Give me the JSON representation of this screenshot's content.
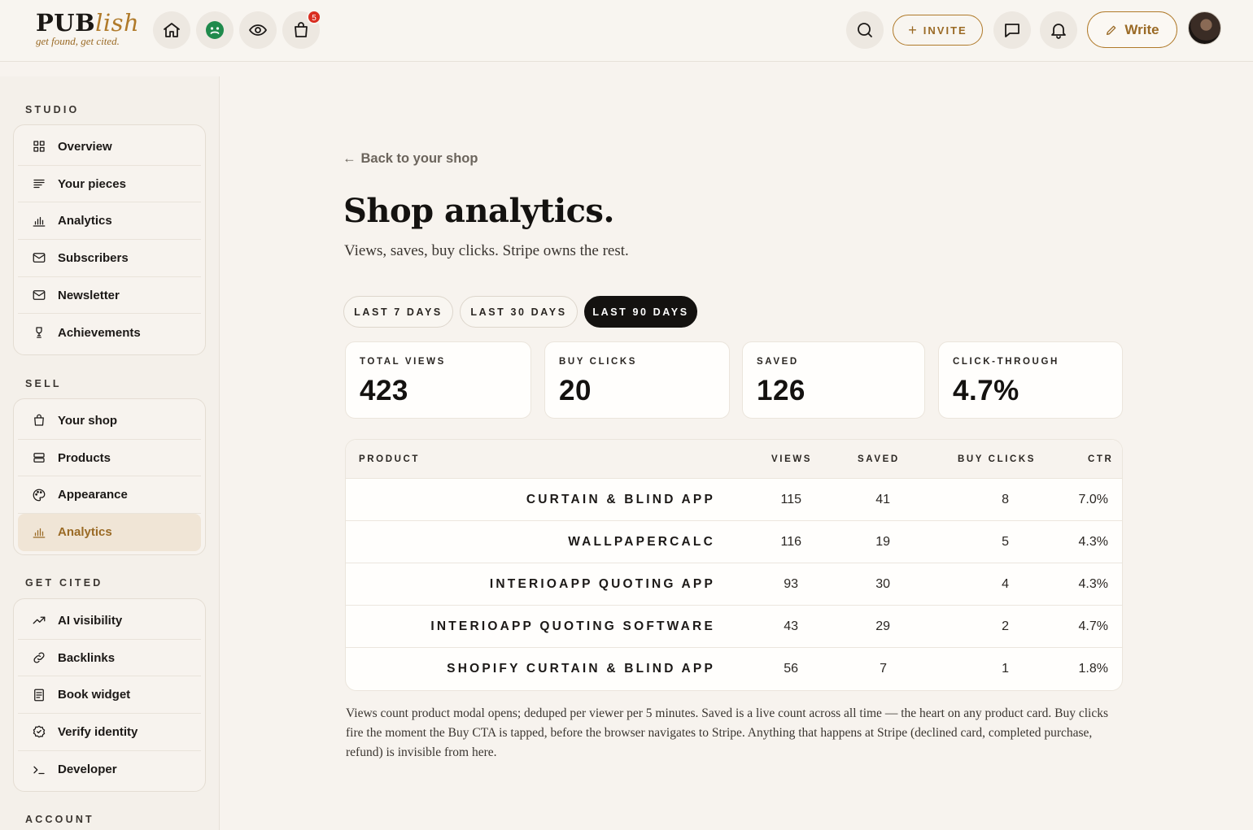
{
  "brand": {
    "name_main": "PUB",
    "name_accent": "lish",
    "tagline": "get found, get cited."
  },
  "topbar": {
    "cart_badge": "5",
    "invite_label": "INVITE",
    "write_label": "Write"
  },
  "sidebar": {
    "studio_title": "STUDIO",
    "studio_items": [
      {
        "label": "Overview",
        "icon": "grid-icon"
      },
      {
        "label": "Your pieces",
        "icon": "lines-icon"
      },
      {
        "label": "Analytics",
        "icon": "bar-chart-icon"
      },
      {
        "label": "Subscribers",
        "icon": "mail-icon"
      },
      {
        "label": "Newsletter",
        "icon": "mail-icon"
      },
      {
        "label": "Achievements",
        "icon": "trophy-icon"
      }
    ],
    "sell_title": "SELL",
    "sell_items": [
      {
        "label": "Your shop",
        "icon": "bag-icon"
      },
      {
        "label": "Products",
        "icon": "stack-icon"
      },
      {
        "label": "Appearance",
        "icon": "palette-icon"
      },
      {
        "label": "Analytics",
        "icon": "bar-chart-icon",
        "active": true
      }
    ],
    "cited_title": "GET CITED",
    "cited_items": [
      {
        "label": "AI visibility",
        "icon": "trend-icon"
      },
      {
        "label": "Backlinks",
        "icon": "link-icon"
      },
      {
        "label": "Book widget",
        "icon": "document-icon"
      },
      {
        "label": "Verify identity",
        "icon": "badge-check-icon"
      },
      {
        "label": "Developer",
        "icon": "terminal-icon"
      }
    ],
    "account_title": "ACCOUNT"
  },
  "main": {
    "back_label": "Back to your shop",
    "title": "Shop analytics.",
    "subtitle": "Views, saves, buy clicks. Stripe owns the rest.",
    "ranges": [
      "LAST 7 DAYS",
      "LAST 30 DAYS",
      "LAST 90 DAYS"
    ],
    "active_range": "LAST 90 DAYS",
    "stats": [
      {
        "label": "TOTAL VIEWS",
        "value": "423"
      },
      {
        "label": "BUY CLICKS",
        "value": "20"
      },
      {
        "label": "SAVED",
        "value": "126"
      },
      {
        "label": "CLICK-THROUGH",
        "value": "4.7%"
      }
    ],
    "table": {
      "headers": {
        "product": "PRODUCT",
        "views": "VIEWS",
        "saved": "SAVED",
        "buy_clicks": "BUY CLICKS",
        "ctr": "CTR"
      },
      "rows": [
        {
          "product": "CURTAIN & BLIND APP",
          "views": "115",
          "saved": "41",
          "buy_clicks": "8",
          "ctr": "7.0%"
        },
        {
          "product": "WALLPAPERCALC",
          "views": "116",
          "saved": "19",
          "buy_clicks": "5",
          "ctr": "4.3%"
        },
        {
          "product": "INTERIOAPP QUOTING APP",
          "views": "93",
          "saved": "30",
          "buy_clicks": "4",
          "ctr": "4.3%"
        },
        {
          "product": "INTERIOAPP QUOTING SOFTWARE",
          "views": "43",
          "saved": "29",
          "buy_clicks": "2",
          "ctr": "4.7%"
        },
        {
          "product": "SHOPIFY CURTAIN & BLIND APP",
          "views": "56",
          "saved": "7",
          "buy_clicks": "1",
          "ctr": "1.8%"
        }
      ]
    },
    "footnote": "Views count product modal opens; deduped per viewer per 5 minutes. Saved is a live count across all time — the heart on any product card. Buy clicks fire the moment the Buy CTA is tapped, before the browser navigates to Stripe. Anything that happens at Stripe (declined card, completed purchase, refund) is invisible from here."
  },
  "colors": {
    "accent": "#b07a2a",
    "background": "#f7f3ee",
    "active_tab": "#141210",
    "badge": "#d92d20"
  }
}
